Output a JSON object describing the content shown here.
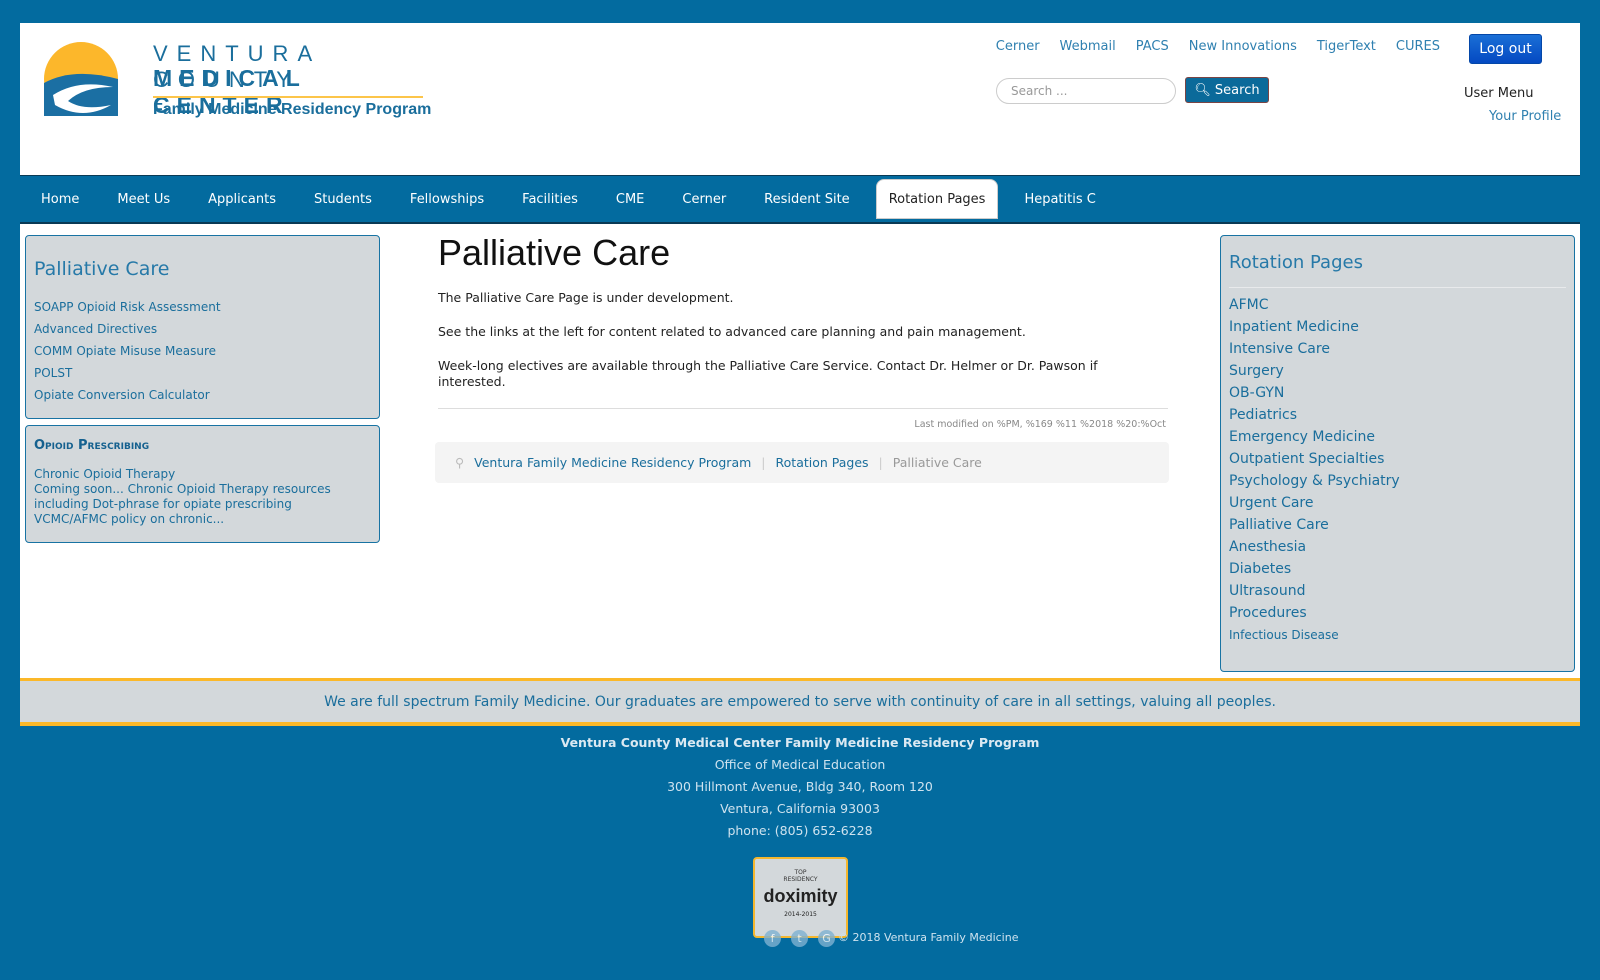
{
  "header": {
    "logo": {
      "line1": "VENTURA COUNTY",
      "line2": "MEDICAL CENTER",
      "line3": "Family Medicine Residency Program"
    },
    "top_links": [
      "Cerner",
      "Webmail",
      "PACS",
      "New Innovations",
      "TigerText",
      "CURES"
    ],
    "logout_label": "Log out",
    "search_placeholder": "Search ...",
    "search_button": "Search",
    "user_menu_title": "User Menu",
    "user_menu_items": [
      "Your Profile"
    ]
  },
  "nav": {
    "items": [
      "Home",
      "Meet Us",
      "Applicants",
      "Students",
      "Fellowships",
      "Facilities",
      "CME",
      "Cerner",
      "Resident Site",
      "Rotation Pages",
      "Hepatitis C"
    ],
    "active": "Rotation Pages"
  },
  "left_sidebar": {
    "box1": {
      "title": "Palliative Care",
      "links": [
        "SOAPP Opioid Risk Assessment",
        "Advanced Directives",
        "COMM Opiate Misuse Measure",
        "POLST",
        "Opiate Conversion Calculator"
      ]
    },
    "box2": {
      "title": "Opioid Prescribing",
      "link": "Chronic Opioid Therapy",
      "lines": [
        "Coming soon... Chronic Opioid Therapy resources",
        "including Dot-phrase for opiate prescribing",
        "VCMC/AFMC policy on chronic..."
      ]
    }
  },
  "main": {
    "title": "Palliative Care",
    "paragraphs": [
      "The Palliative Care Page is under development.",
      "See the links at the left for content related to advanced care planning and pain management.",
      "Week-long electives are available through the Palliative Care Service.  Contact Dr. Helmer or Dr. Pawson if interested."
    ],
    "last_modified": "Last modified on %PM, %169 %11 %2018 %20:%Oct",
    "breadcrumb": [
      "Ventura Family Medicine Residency Program",
      "Rotation Pages",
      "Palliative Care"
    ]
  },
  "right_sidebar": {
    "title": "Rotation Pages",
    "links": [
      "AFMC",
      "Inpatient Medicine",
      "Intensive Care",
      "Surgery",
      "OB-GYN",
      "Pediatrics",
      "Emergency Medicine",
      "Outpatient Specialties",
      "Psychology & Psychiatry",
      "Urgent Care",
      "Palliative Care",
      "Anesthesia",
      "Diabetes",
      "Ultrasound",
      "Procedures",
      "Infectious Disease"
    ]
  },
  "tagline": "We are full spectrum Family Medicine. Our graduates are empowered to serve with continuity of care in all settings, valuing all peoples.",
  "footer": {
    "org": "Ventura County Medical Center Family Medicine Residency Program",
    "lines": [
      "Office of Medical Education",
      "300 Hillmont Avenue, Bldg 340, Room 120",
      "Ventura, California 93003",
      "phone: (805) 652-6228"
    ],
    "badge": {
      "top": "TOP",
      "sub": "RESIDENCY",
      "brand": "doximity",
      "years": "2014-2015"
    },
    "social": [
      "facebook-icon",
      "twitter-icon",
      "google-icon"
    ],
    "copyright": "© 2018 Ventura Family Medicine"
  },
  "colors": {
    "brand_blue": "#036b9f",
    "accent_yellow": "#fbb829",
    "box_gray": "#d3d8db",
    "link": "#1a6e9c"
  }
}
